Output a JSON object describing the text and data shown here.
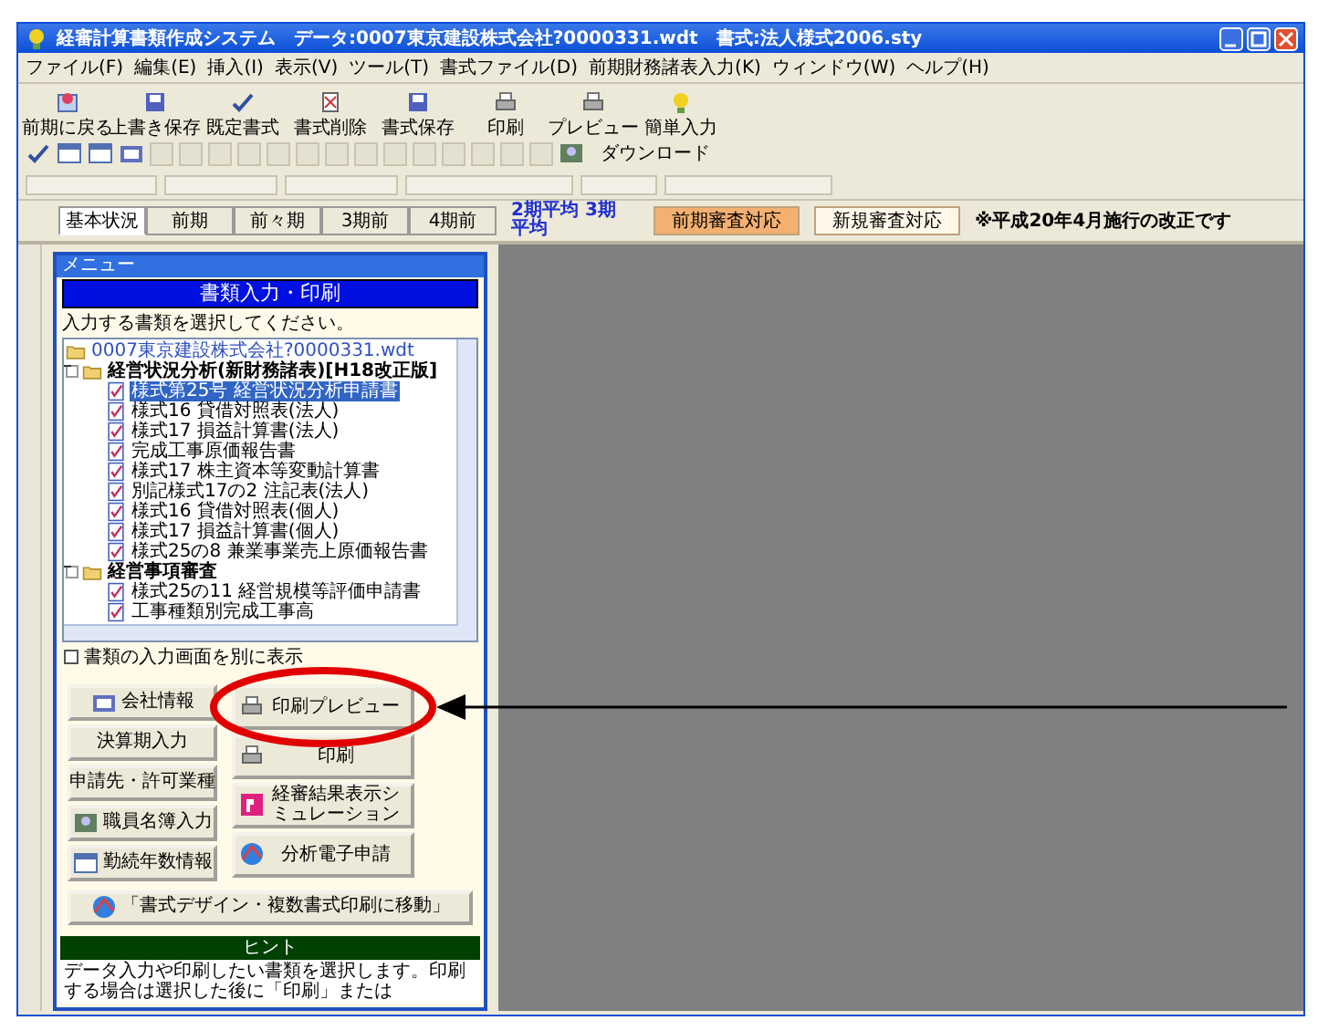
{
  "window": {
    "title": "経審計算書類作成システム　データ:0007東京建設株式会社?0000331.wdt　書式:法人様式2006.sty"
  },
  "menu": [
    "ファイル(F)",
    "編集(E)",
    "挿入(I)",
    "表示(V)",
    "ツール(T)",
    "書式ファイル(D)",
    "前期財務諸表入力(K)",
    "ウィンドウ(W)",
    "ヘルプ(H)"
  ],
  "toolbar": [
    {
      "label": "前期に戻る",
      "kind": "back"
    },
    {
      "label": "上書き保存",
      "kind": "save"
    },
    {
      "label": "既定書式",
      "kind": "check"
    },
    {
      "label": "書式削除",
      "kind": "delete"
    },
    {
      "label": "書式保存",
      "kind": "save"
    },
    {
      "label": "印刷",
      "kind": "print"
    },
    {
      "label": "プレビュー",
      "kind": "print"
    },
    {
      "label": "簡単入力",
      "kind": "bulb"
    }
  ],
  "toolbar2": {
    "download": "ダウンロード"
  },
  "tabs": [
    {
      "label": "基本状況",
      "selected": true
    },
    {
      "label": "前期",
      "selected": false
    },
    {
      "label": "前々期",
      "selected": false
    },
    {
      "label": "3期前",
      "selected": false
    },
    {
      "label": "4期前",
      "selected": false
    }
  ],
  "average_label": "2期平均 3期平均",
  "review_buttons": [
    {
      "label": "前期審査対応",
      "selected": true
    },
    {
      "label": "新規審査対応",
      "selected": false
    }
  ],
  "notice": "※平成20年4月施行の改正です",
  "panel": {
    "title": "メニュー",
    "header": "書類入力・印刷",
    "prompt": "入力する書類を選択してください。",
    "tree": {
      "label": "0007東京建設株式会社?0000331.wdt",
      "children": [
        {
          "label": "経営状況分析(新財務諸表)[H18改正版]",
          "expanded": true,
          "children": [
            {
              "label": "様式第25号 経営状況分析申請書",
              "selected": true
            },
            {
              "label": "様式16 貸借対照表(法人)",
              "selected": false
            },
            {
              "label": "様式17 損益計算書(法人)",
              "selected": false
            },
            {
              "label": "完成工事原価報告書",
              "selected": false
            },
            {
              "label": "様式17 株主資本等変動計算書",
              "selected": false
            },
            {
              "label": "別記様式17の2 注記表(法人)",
              "selected": false
            },
            {
              "label": "様式16 貸借対照表(個人)",
              "selected": false
            },
            {
              "label": "様式17 損益計算書(個人)",
              "selected": false
            },
            {
              "label": "様式25の8 兼業事業売上原価報告書",
              "selected": false
            }
          ]
        },
        {
          "label": "経営事項審査",
          "expanded": true,
          "children": [
            {
              "label": "様式25の11 経営規模等評価申請書",
              "selected": false
            },
            {
              "label": "工事種類別完成工事高",
              "selected": false
            }
          ]
        }
      ]
    },
    "checkbox": {
      "label": "書類の入力画面を別に表示",
      "checked": false
    },
    "left_buttons": [
      {
        "label": "会社情報",
        "kind": "card"
      },
      {
        "label": "決算期入力",
        "kind": "none"
      },
      {
        "label": "申請先・許可業種",
        "kind": "none"
      },
      {
        "label": "職員名簿入力",
        "kind": "people"
      },
      {
        "label": "勤続年数情報",
        "kind": "window"
      }
    ],
    "right_buttons": [
      {
        "label": "印刷プレビュー",
        "kind": "print"
      },
      {
        "label": "印刷",
        "kind": "print"
      },
      {
        "label": "経審結果表示シミュレーション",
        "kind": "p"
      },
      {
        "label": "分析電子申請",
        "kind": "globe"
      }
    ],
    "wide_button": "「書式デザイン・複数書式印刷に移動」",
    "hint": {
      "title": "ヒント",
      "text": "データ入力や印刷したい書類を選択します。印刷する場合は選択した後に「印刷」または"
    }
  },
  "callout": {
    "kind": "ellipse-arrow"
  }
}
